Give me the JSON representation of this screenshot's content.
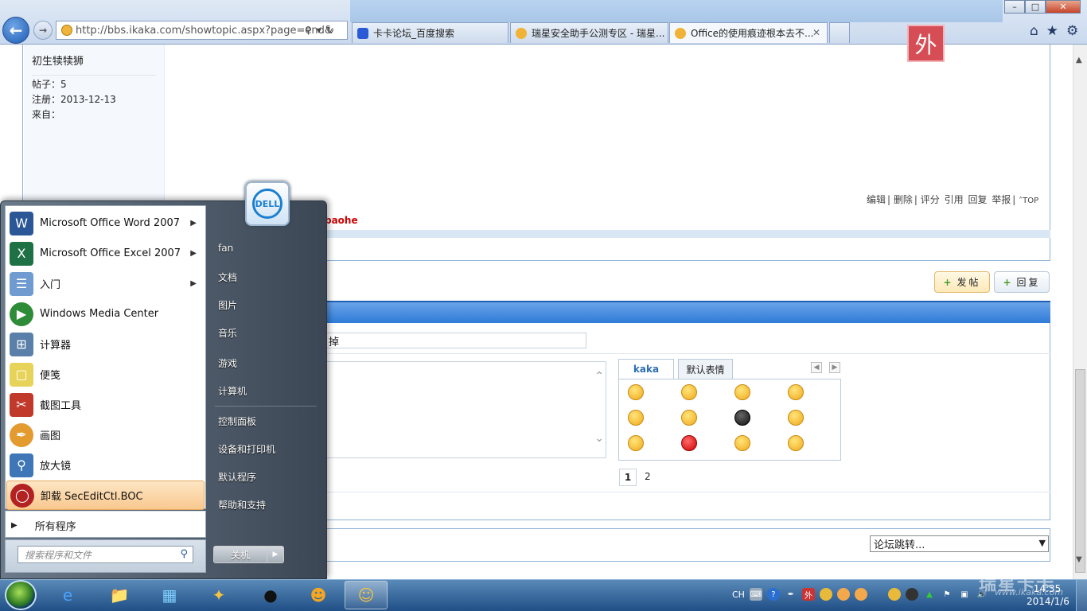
{
  "browser": {
    "url": "http://bbs.ikaka.com/showtopic.aspx?page=end&",
    "tabs": [
      {
        "label": "卡卡论坛_百度搜索"
      },
      {
        "label": "瑞星安全助手公测专区 - 瑞星..."
      },
      {
        "label": "Office的使用痕迹根本去不..."
      }
    ],
    "badge": "外"
  },
  "post": {
    "username": "初生犊犊狮",
    "posts": "帖子：5",
    "registered": "注册：2013-12-13",
    "from": "来自：",
    "actions": [
      "编辑",
      "删除",
      "评分",
      "引用",
      "回复",
      "举报"
    ],
    "top": "TOP",
    "signature": "导区病毒TDSS TDL4 by baohe"
  },
  "buttons": {
    "new_post": "发帖",
    "reply": "回复"
  },
  "reply": {
    "title_value": "掉",
    "smiley_tabs": [
      "kaka",
      "默认表情"
    ],
    "pages": [
      "1",
      "2"
    ]
  },
  "forum_jump": "论坛跳转...",
  "start_menu": {
    "left_items": [
      {
        "label": "Microsoft Office Word 2007",
        "icon": "word-icon",
        "color": "#2b5797"
      },
      {
        "label": "Microsoft Office Excel 2007",
        "icon": "excel-icon",
        "color": "#1e7145"
      },
      {
        "label": "入门",
        "icon": "getting-started-icon",
        "color": "#6f9bd1"
      },
      {
        "label": "Windows Media Center",
        "icon": "media-center-icon",
        "color": "#2e8b37"
      },
      {
        "label": "计算器",
        "icon": "calculator-icon",
        "color": "#5a7fa8"
      },
      {
        "label": "便笺",
        "icon": "sticky-notes-icon",
        "color": "#e8d35a"
      },
      {
        "label": "截图工具",
        "icon": "snipping-tool-icon",
        "color": "#c0392b"
      },
      {
        "label": "画图",
        "icon": "paint-icon",
        "color": "#e39b2f"
      },
      {
        "label": "放大镜",
        "icon": "magnifier-icon",
        "color": "#3e76b8"
      },
      {
        "label": "卸载 SecEditCtl.BOC",
        "icon": "uninstall-icon",
        "color": "#b22222"
      }
    ],
    "all_programs": "所有程序",
    "search_placeholder": "搜索程序和文件",
    "right_items": [
      "fan",
      "文档",
      "图片",
      "音乐",
      "游戏",
      "计算机",
      "控制面板",
      "设备和打印机",
      "默认程序",
      "帮助和支持"
    ],
    "shutdown": "关机"
  },
  "taskbar": {
    "lang": "CH",
    "time": "14:35",
    "date": "2014/1/6"
  },
  "watermark": {
    "brand": "瑞星卡卡",
    "url": "www.ikaka.com"
  }
}
